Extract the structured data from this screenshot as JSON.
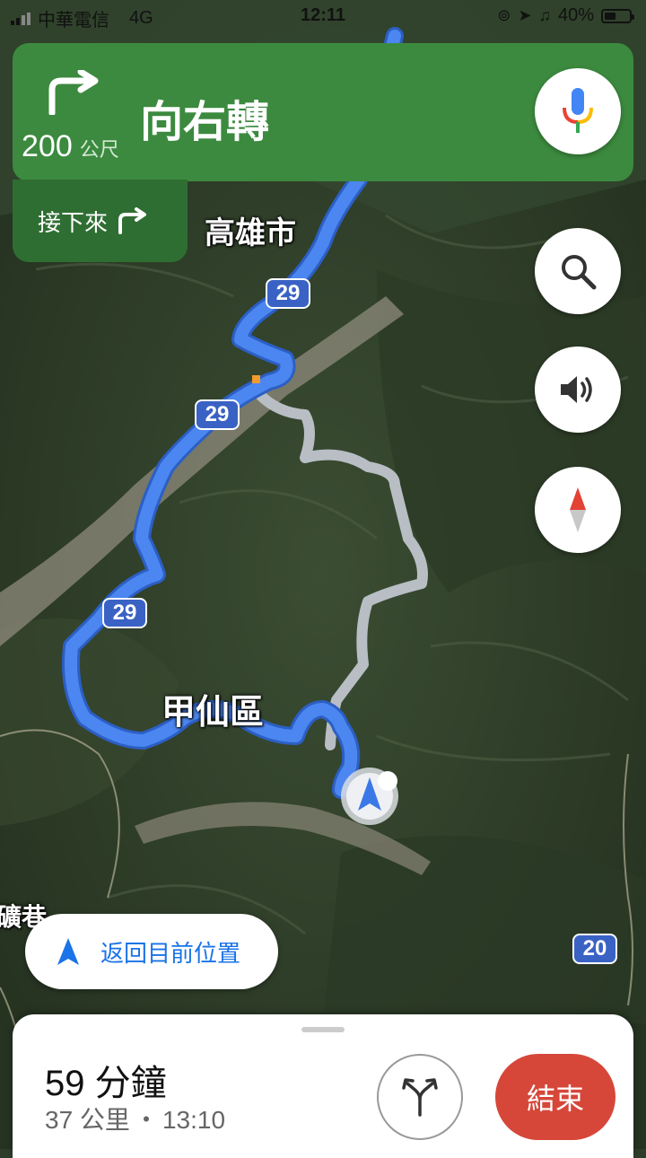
{
  "status_bar": {
    "carrier": "中華電信",
    "network": "4G",
    "time": "12:11",
    "battery": "40%"
  },
  "navigation": {
    "turn_icon": "turn-right-arrow-icon",
    "distance": "200",
    "distance_unit": "公尺",
    "instruction": "向右轉",
    "next_label": "接下來",
    "next_icon": "turn-right-arrow-icon"
  },
  "map": {
    "labels": {
      "kaohsiung": "高雄市",
      "jiaxian": "甲仙區",
      "lane": "礦巷"
    },
    "road_shields": [
      "29",
      "29",
      "29",
      "20"
    ]
  },
  "controls": {
    "mic_icon": "microphone-icon",
    "search_icon": "search-icon",
    "sound_icon": "speaker-icon",
    "compass_icon": "compass-icon"
  },
  "recenter": {
    "label": "返回目前位置"
  },
  "trip": {
    "duration": "59 分鐘",
    "distance": "37 公里",
    "separator": "・",
    "arrival": "13:10",
    "end_label": "結束",
    "alt_routes_icon": "alternate-routes-icon"
  },
  "colors": {
    "nav_green": "#3c8a3f",
    "next_green": "#2f6e33",
    "route_blue": "#4c86f0",
    "alt_route_gray": "#b8bec4",
    "end_red": "#d6473a"
  }
}
